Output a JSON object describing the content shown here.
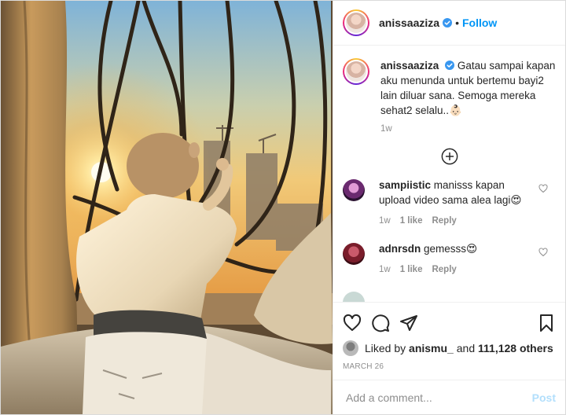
{
  "post": {
    "username": "anissaaziza",
    "follow_label": "Follow",
    "separator": "•",
    "caption": "Gatau sampai kapan aku menunda untuk bertemu bayi2 lain diluar sana. Semoga mereka sehat2 selalu..👶🏻",
    "caption_time": "1w"
  },
  "comments": [
    {
      "username": "sampiistic",
      "text": "manisss kapan upload video sama alea lagi😍",
      "time": "1w",
      "likes": "1 like",
      "reply": "Reply",
      "avatar_color": "#6b2a6f"
    },
    {
      "username": "adnrsdn",
      "text": "gemesss😍",
      "time": "1w",
      "likes": "1 like",
      "reply": "Reply",
      "avatar_color": "#7a1d2b"
    }
  ],
  "likes": {
    "prefix": "Liked by",
    "user": "anismu_",
    "and": "and",
    "count": "111,128 others"
  },
  "date": "MARCH 26",
  "add_comment": {
    "placeholder": "Add a comment...",
    "post_label": "Post"
  },
  "colors": {
    "accent": "#0095f6",
    "post_disabled": "#b2dffc",
    "muted": "#8e8e8e"
  },
  "icons": [
    "verified-badge-icon",
    "add-circle-icon",
    "heart-icon",
    "comment-icon",
    "share-icon",
    "bookmark-icon"
  ]
}
